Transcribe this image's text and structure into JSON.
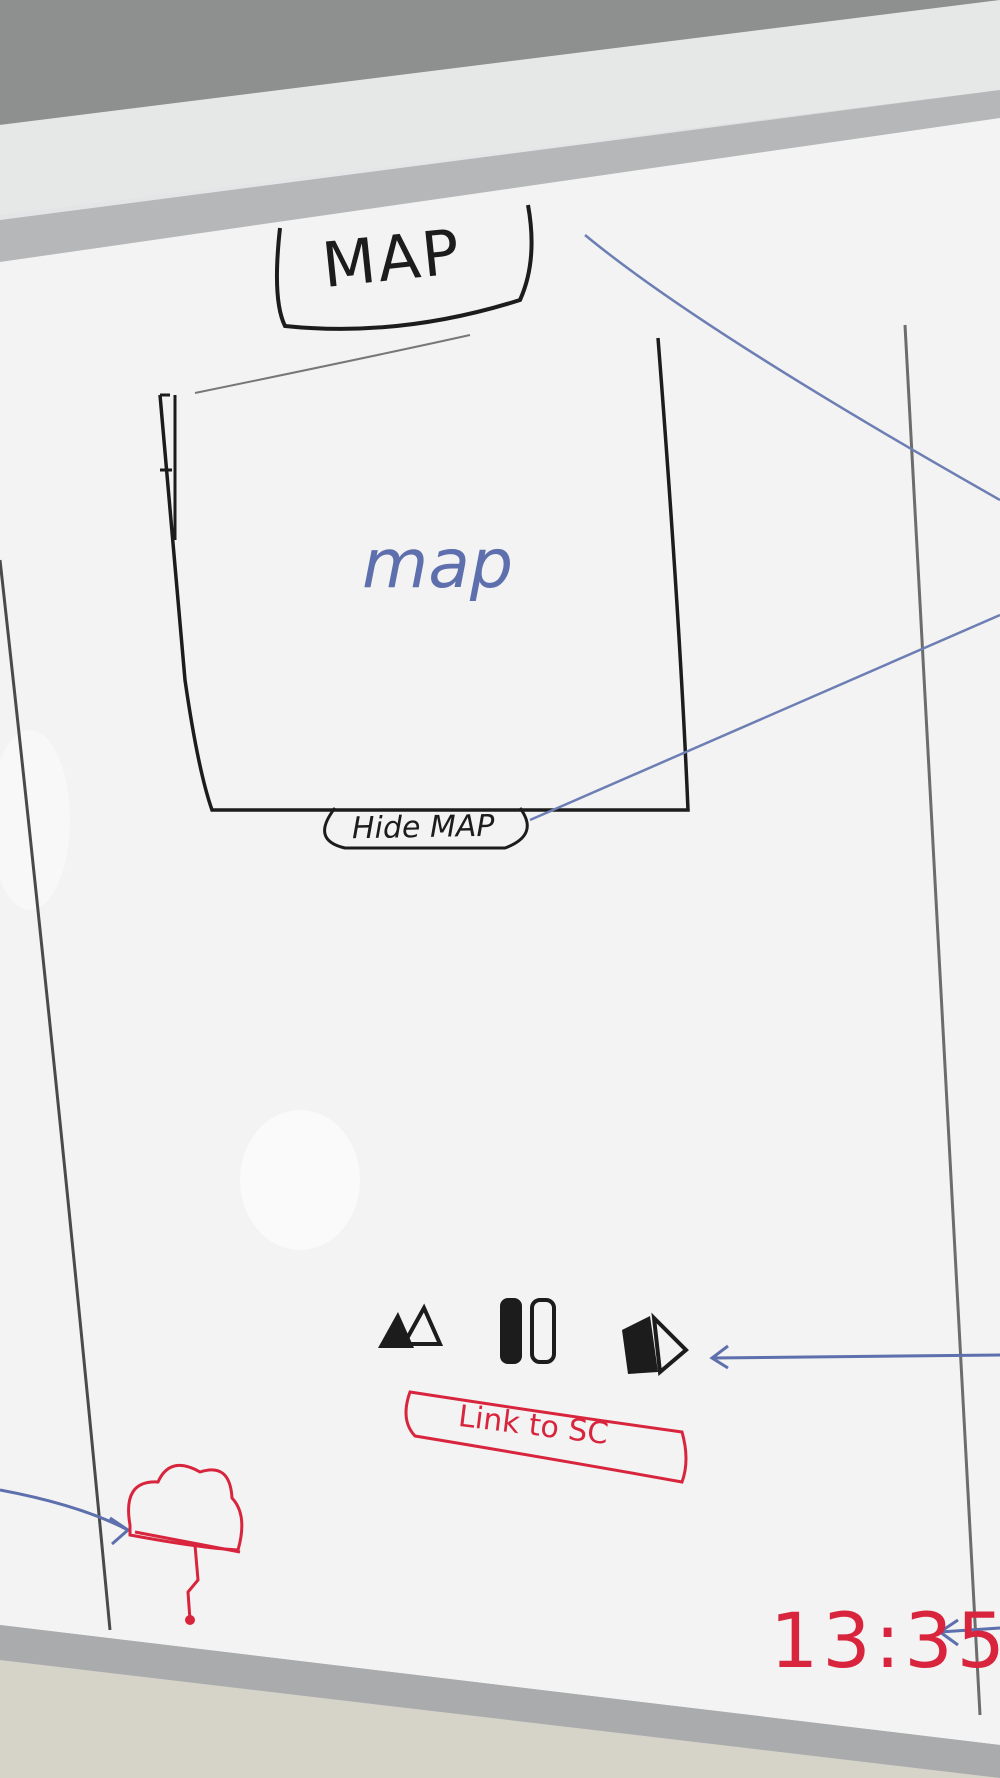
{
  "scene": {
    "description_kind": "whiteboard wireframe sketch",
    "colors": {
      "board": "#f1f2f1",
      "frame": "#b7b9ba",
      "black_marker": "#1c1c1c",
      "blue_marker": "#5e6fae",
      "red_marker": "#d8253d"
    }
  },
  "header": {
    "title": "MAP"
  },
  "map_panel": {
    "label": "map",
    "hide_button_label": "Hide MAP"
  },
  "media_controls": {
    "icons": [
      "rewind-icon",
      "pause-icon",
      "fast-forward-icon"
    ]
  },
  "link_button": {
    "label": "Link to SC"
  },
  "weather": {
    "icon": "cloud-icon"
  },
  "clock": {
    "time": "13:35"
  }
}
